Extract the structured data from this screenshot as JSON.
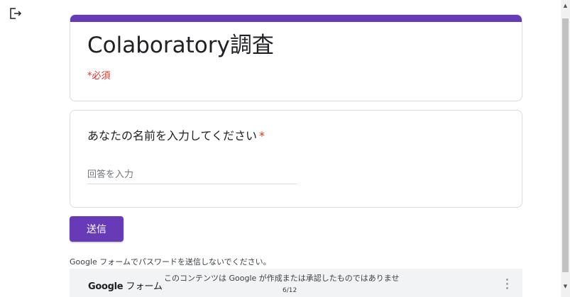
{
  "form": {
    "title": "Colaboratory調査",
    "required_note": "*必須",
    "accent_color": "#673ab7",
    "required_color": "#d93025"
  },
  "question": {
    "label": "あなたの名前を入力してください",
    "required_mark": "*",
    "placeholder": "回答を入力",
    "value": ""
  },
  "actions": {
    "submit_label": "送信"
  },
  "warning": "Google フォームでパスワードを送信しないでください。",
  "footer": {
    "brand_google": "Google",
    "brand_forms": " フォーム",
    "disclaimer": "このコンテンツは Google が作成または承認したものではありませ",
    "page_indicator": "6/12"
  },
  "icons": {
    "exit": "exit-icon",
    "more": "more-vert-icon",
    "scroll_up": "arrow-up-icon",
    "scroll_down": "arrow-down-icon"
  }
}
